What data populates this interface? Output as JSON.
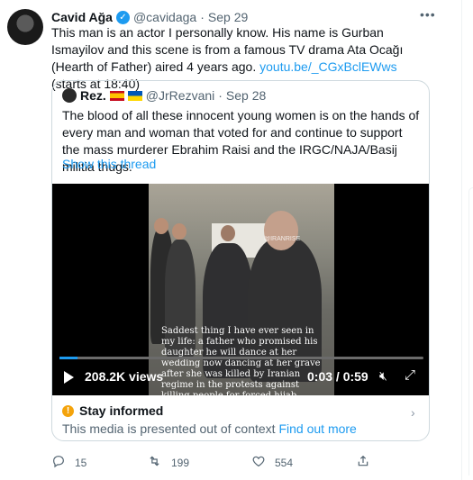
{
  "tweet": {
    "author_name": "Cavid Ağa",
    "handle": "@cavidaga",
    "separator": "·",
    "date": "Sep 29",
    "text": "This man is an actor I personally know. His name is Gurban Ismayilov and this scene is from a famous TV drama Ata Ocağı (Hearth of Father) aired 4 years ago.",
    "link_text": "youtu.be/_CGxBclEWws",
    "link_suffix": "(starts at 18:40)"
  },
  "quote": {
    "author_name": "Rez.",
    "handle": "@JrRezvani",
    "separator": "·",
    "date": "Sep 28",
    "text": "The blood of all these innocent young women is on the hands of every man and woman that voted for and continue to support the mass murderer Ebrahim Raisi and the IRGC/NAJA/Basij militia thugs.",
    "show_thread": "Show this thread",
    "video": {
      "caption": "Saddest thing I have ever seen in my life: a father who promised his daughter he will dance at her wedding now dancing at her grave after she was killed by Iranian regime in the protests against killing people for forced hijab",
      "watermark": "@IRANRISE",
      "views": "208.2K views",
      "time": "0:03 / 0:59",
      "progress": 0.05
    },
    "notice_title": "Stay informed",
    "notice_text": "This media is presented out of context",
    "notice_link": "Find out more"
  },
  "actions": {
    "replies": "15",
    "retweets": "199",
    "likes": "554"
  },
  "colors": {
    "accent": "#1d9bf0",
    "notice": "#f4a30b",
    "verified": "#1d9bf0"
  }
}
